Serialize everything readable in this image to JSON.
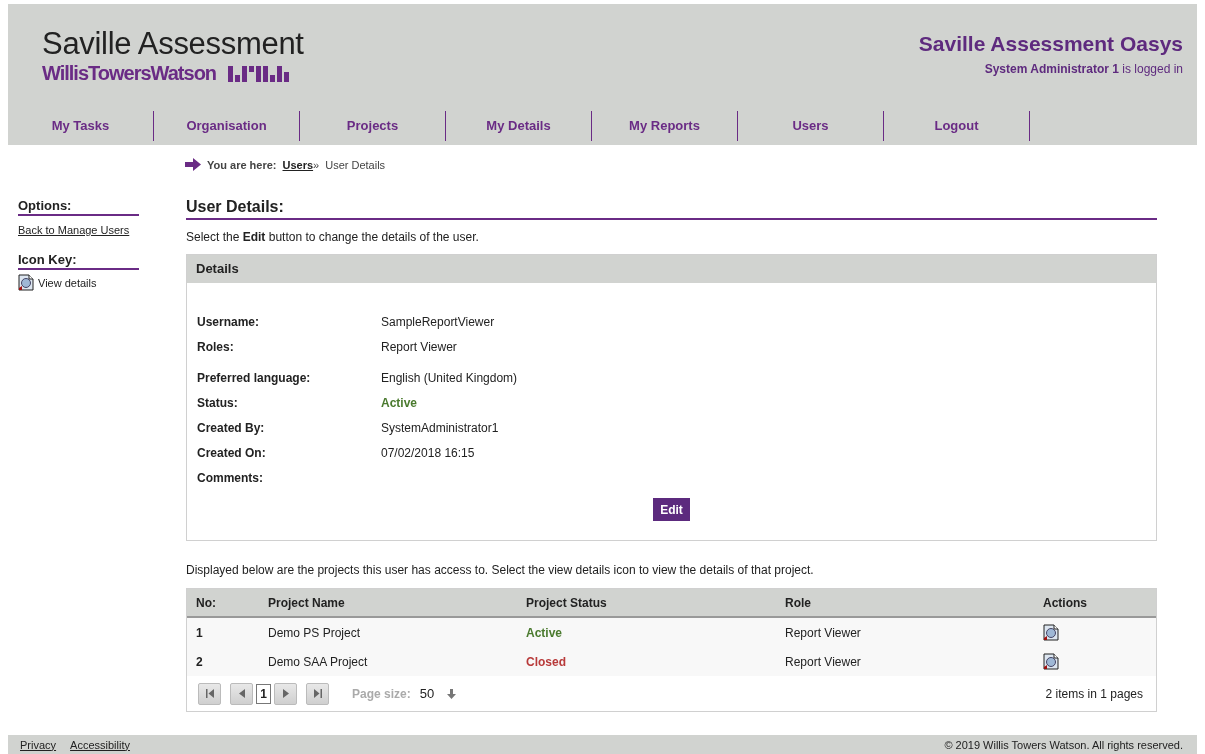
{
  "header": {
    "brand": "Saville Assessment",
    "sub_brand": "WillisTowersWatson",
    "app_title": "Saville Assessment Oasys",
    "user": "System Administrator 1",
    "user_suffix": "is logged in"
  },
  "nav": [
    {
      "label": "My Tasks"
    },
    {
      "label": "Organisation"
    },
    {
      "label": "Projects"
    },
    {
      "label": "My Details"
    },
    {
      "label": "My Reports"
    },
    {
      "label": "Users"
    },
    {
      "label": "Logout"
    }
  ],
  "breadcrumb": {
    "prefix": "You are here:",
    "link": "Users",
    "separator": "»",
    "current": "User Details"
  },
  "sidebar": {
    "options_title": "Options:",
    "options": [
      {
        "label": "Back to Manage Users"
      }
    ],
    "icon_key_title": "Icon Key:",
    "icon_key": [
      {
        "label": "View details"
      }
    ]
  },
  "page": {
    "title": "User Details:",
    "intro": "Select the **Edit** button to change the details of the user."
  },
  "details": {
    "title": "Details",
    "groups": [
      {
        "fields": [
          {
            "label": "Username:",
            "value": "SampleReportViewer"
          },
          {
            "label": "Roles:",
            "value": "Report Viewer"
          }
        ]
      },
      {
        "fields": [
          {
            "label": "Preferred language:",
            "value": "English (United Kingdom)"
          },
          {
            "label": "Status:",
            "value": "Active",
            "color": "#4a7a2e"
          },
          {
            "label": "Created By:",
            "value": "SystemAdministrator1"
          },
          {
            "label": "Created On:",
            "value": "07/02/2018 16:15"
          },
          {
            "label": "Comments:"
          }
        ]
      }
    ],
    "button": "Edit"
  },
  "projects_intro": "Displayed below are the projects this user has access to. Select the view details icon to view the details of that project.",
  "table": {
    "columns": [
      "No:",
      "Project Name",
      "Project Status",
      "Role",
      "Actions"
    ],
    "rows": [
      {
        "no": "1",
        "name": "Demo PS Project",
        "status": "Active",
        "color": "#4a7a2e",
        "role": "Report Viewer"
      },
      {
        "no": "2",
        "name": "Demo SAA Project",
        "status": "Closed",
        "color": "#b83a3a",
        "role": "Report Viewer"
      }
    ]
  },
  "pager": {
    "pages": [
      {
        "label": "1",
        "selected": true
      }
    ],
    "page_size_label": "Page size:",
    "page_size": "50",
    "summary": "2 items in 1 pages"
  },
  "footer": {
    "links": [
      "Privacy",
      "Accessibility"
    ],
    "copyright": "© 2019 Willis Towers Watson. All rights reserved."
  }
}
